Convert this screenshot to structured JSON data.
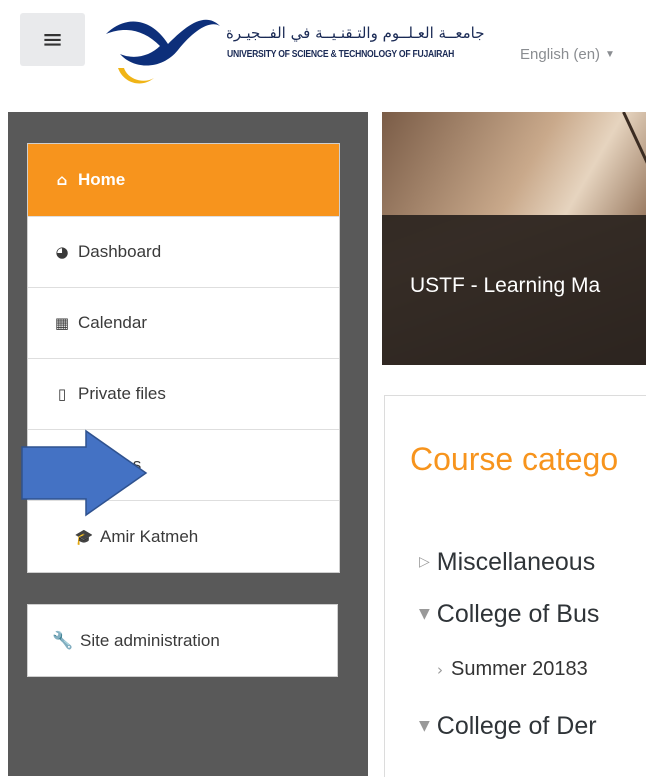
{
  "header": {
    "logo_arabic": "جامعــة العـلــوم والتـقنـيــة في الفــجيـرة",
    "logo_english": "UNIVERSITY OF SCIENCE & TECHNOLOGY OF FUJAIRAH",
    "language": "English (en)",
    "menu_icon": "hamburger-icon"
  },
  "sidebar": {
    "items": [
      {
        "label": "Home",
        "icon": "home-icon",
        "active": true
      },
      {
        "label": "Dashboard",
        "icon": "dashboard-icon"
      },
      {
        "label": "Calendar",
        "icon": "calendar-icon"
      },
      {
        "label": "Private files",
        "icon": "file-icon"
      },
      {
        "label": "Courses",
        "icon": "courses-icon"
      },
      {
        "label": "Amir Katmeh",
        "icon": "graduation-cap-icon"
      }
    ],
    "admin": {
      "label": "Site administration",
      "icon": "wrench-icon"
    }
  },
  "hero": {
    "title": "USTF - Learning Ma"
  },
  "main": {
    "heading": "Course catego",
    "categories": [
      {
        "label": "Miscellaneous",
        "state": "collapsed"
      },
      {
        "label": "College of Bus",
        "state": "expanded"
      },
      {
        "label": "Summer 20183",
        "state": "sub"
      },
      {
        "label": "College of Der",
        "state": "expanded"
      }
    ]
  },
  "colors": {
    "accent": "#f7941d",
    "sidebar_bg": "#595959",
    "overlay_arrow": "#4472c4"
  }
}
